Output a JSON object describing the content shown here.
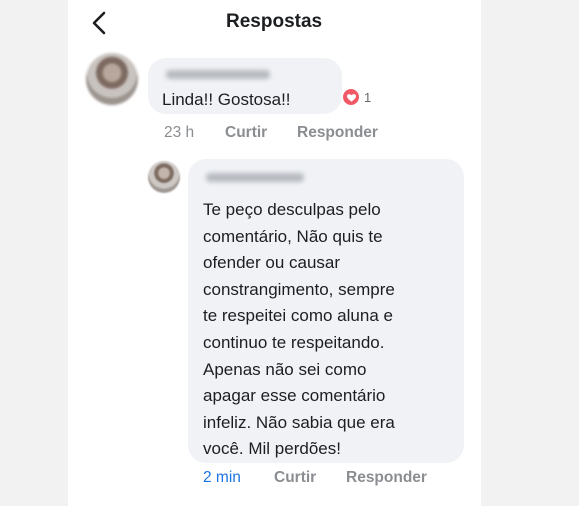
{
  "header": {
    "title": "Respostas"
  },
  "comments": [
    {
      "text": "Linda!! Gostosa!!",
      "reaction_count": "1",
      "time": "23 h",
      "like_label": "Curtir",
      "reply_label": "Responder"
    },
    {
      "text": "Te peço desculpas pelo\ncomentário, Não quis te\nofender ou causar\nconstrangimento, sempre\nte respeitei como aluna e\ncontinuo te respeitando.\nApenas não sei como\napagar esse comentário\ninfeliz. Não sabia que era\nvocê. Mil perdões!",
      "time": "2 min",
      "like_label": "Curtir",
      "reply_label": "Responder"
    }
  ],
  "colors": {
    "bubble": "#f0f2f5",
    "meta_text": "#8a8d91",
    "recent_time": "#1b74e4",
    "heart": "#f05a66"
  },
  "icons": {
    "back": "chevron-left-icon",
    "reaction": "heart-icon"
  }
}
